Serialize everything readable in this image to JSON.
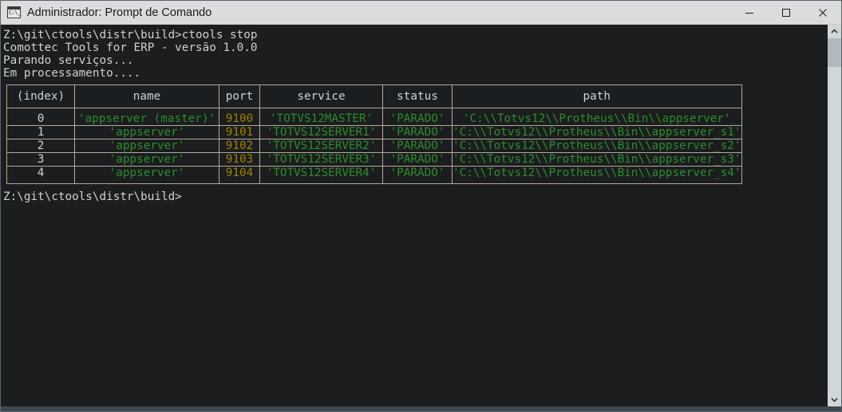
{
  "window": {
    "title": "Administrador: Prompt de Comando",
    "icon": "console-icon",
    "icon_text": "C:\\_",
    "controls": [
      {
        "name": "minimize",
        "glyph": "minimize-icon"
      },
      {
        "name": "maximize",
        "glyph": "maximize-icon"
      },
      {
        "name": "close",
        "glyph": "close-icon"
      }
    ]
  },
  "colors": {
    "titlebar_bg": "#dcdcdc",
    "console_bg": "#1b1d1e",
    "text": "#cfd2d4",
    "green": "#2e8b2e",
    "gold": "#9e8100",
    "table_border": "#b5a99a",
    "scrollbar_bg": "#d3d6d8",
    "scrollbar_thumb": "#b4b9bd"
  },
  "console": {
    "pre_lines": [
      "Z:\\git\\ctools\\distr\\build>ctools stop",
      "Comottec Tools for ERP - versão 1.0.0",
      "Parando serviços...",
      "Em processamento...."
    ],
    "post_lines": [
      "Z:\\git\\ctools\\distr\\build>"
    ]
  },
  "table": {
    "headers": [
      "(index)",
      "name",
      "port",
      "service",
      "status",
      "path"
    ],
    "rows": [
      {
        "index": "0",
        "name": "'appserver (master)'",
        "port": "9100",
        "service": "'TOTVS12MASTER'",
        "status": "'PARADO'",
        "path": "'C:\\\\Totvs12\\\\Protheus\\\\Bin\\\\appserver'"
      },
      {
        "index": "1",
        "name": "'appserver'",
        "port": "9101",
        "service": "'TOTVS12SERVER1'",
        "status": "'PARADO'",
        "path": "'C:\\\\Totvs12\\\\Protheus\\\\Bin\\\\appserver_s1'"
      },
      {
        "index": "2",
        "name": "'appserver'",
        "port": "9102",
        "service": "'TOTVS12SERVER2'",
        "status": "'PARADO'",
        "path": "'C:\\\\Totvs12\\\\Protheus\\\\Bin\\\\appserver_s2'"
      },
      {
        "index": "3",
        "name": "'appserver'",
        "port": "9103",
        "service": "'TOTVS12SERVER3'",
        "status": "'PARADO'",
        "path": "'C:\\\\Totvs12\\\\Protheus\\\\Bin\\\\appserver_s3'"
      },
      {
        "index": "4",
        "name": "'appserver'",
        "port": "9104",
        "service": "'TOTVS12SERVER4'",
        "status": "'PARADO'",
        "path": "'C:\\\\Totvs12\\\\Protheus\\\\Bin\\\\appserver_s4'"
      }
    ]
  },
  "scrollbar": {
    "up_arrow": "chevron-up-icon",
    "down_arrow": "chevron-down-icon"
  }
}
